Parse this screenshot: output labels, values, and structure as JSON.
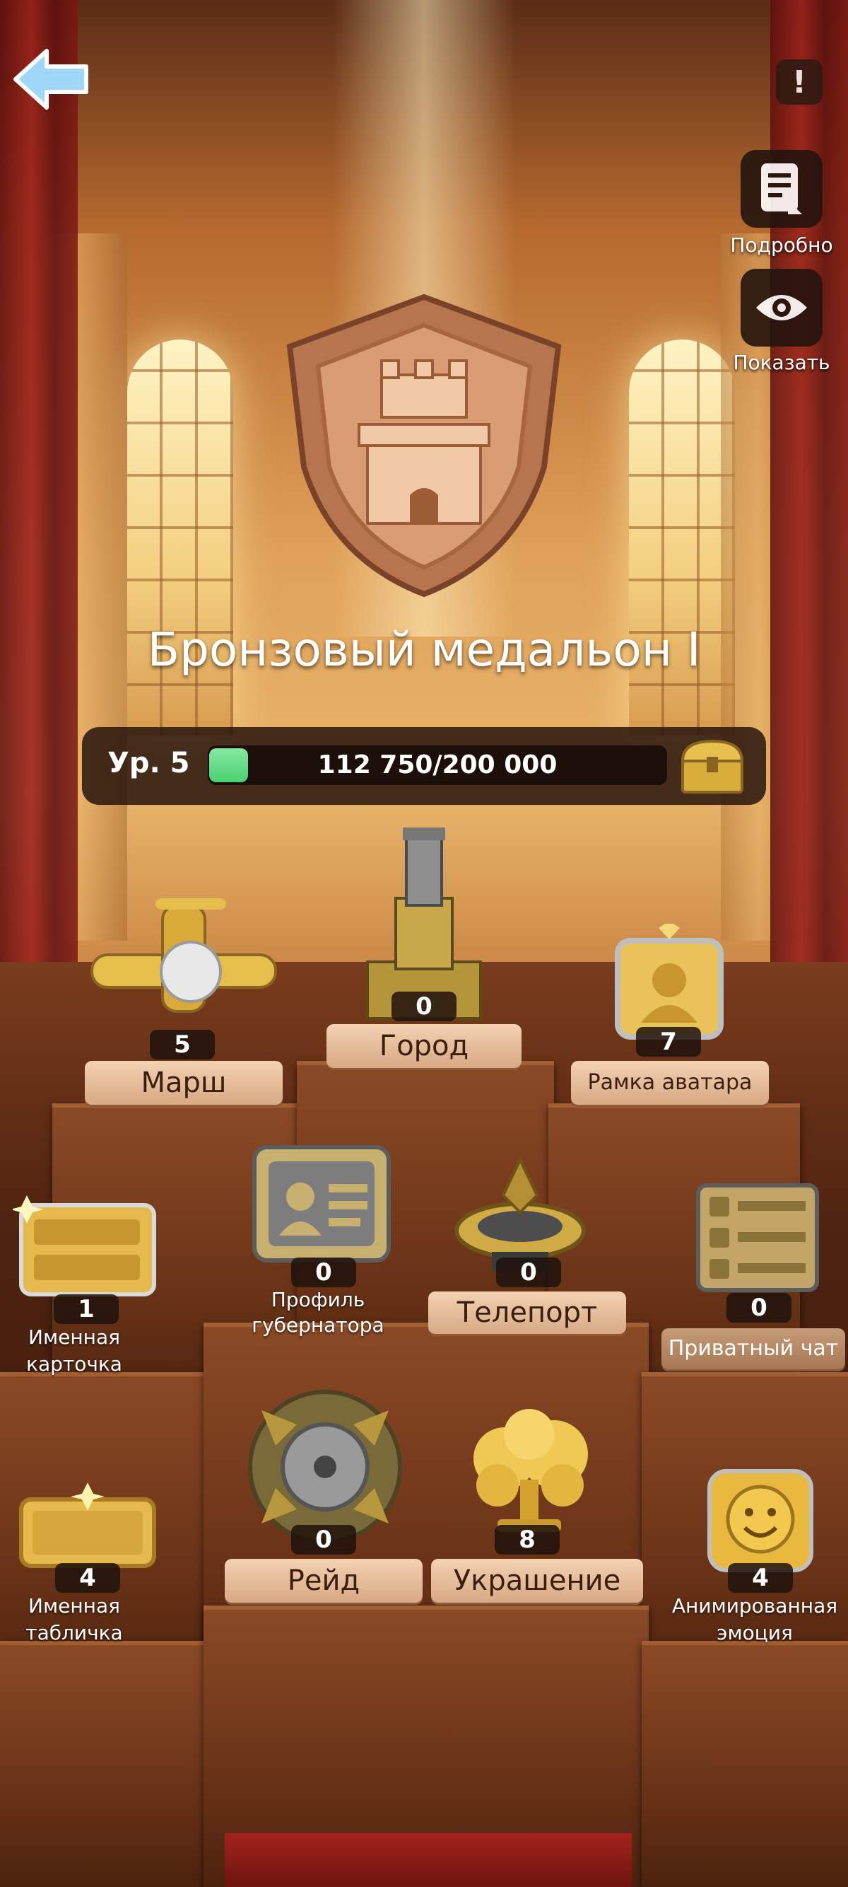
{
  "header": {
    "back_label": "",
    "info_icon": "exclamation-icon",
    "details_label": "Подробно",
    "show_label": "Показать"
  },
  "medal": {
    "title": "Бронзовый медальон I",
    "icon": "castle-shield-icon",
    "color": "#c98a63"
  },
  "level": {
    "label": "Ур. 5",
    "progress_text": "112 750/200 000",
    "current": 112750,
    "max": 200000,
    "bar_color": "#4cd072",
    "reward_icon": "treasure-chest-icon"
  },
  "items": [
    {
      "label": "Марш",
      "count": "5",
      "icon": "plane-icon"
    },
    {
      "label": "Город",
      "count": "0",
      "icon": "castle-tower-icon"
    },
    {
      "label": "Рамка аватара",
      "count": "7",
      "icon": "avatar-frame-icon"
    },
    {
      "label": "Именная карточка",
      "count": "1",
      "icon": "name-card-icon"
    },
    {
      "label": "Профиль губернатора",
      "count": "0",
      "icon": "governor-profile-icon"
    },
    {
      "label": "Телепорт",
      "count": "0",
      "icon": "teleport-icon"
    },
    {
      "label": "Приватный чат",
      "count": "0",
      "icon": "private-chat-icon"
    },
    {
      "label": "Именная табличка",
      "count": "4",
      "icon": "nameplate-icon"
    },
    {
      "label": "Рейд",
      "count": "0",
      "icon": "raid-icon"
    },
    {
      "label": "Украшение",
      "count": "8",
      "icon": "tree-decoration-icon"
    },
    {
      "label": "Анимированная эмоция",
      "count": "4",
      "icon": "smiley-icon"
    }
  ]
}
